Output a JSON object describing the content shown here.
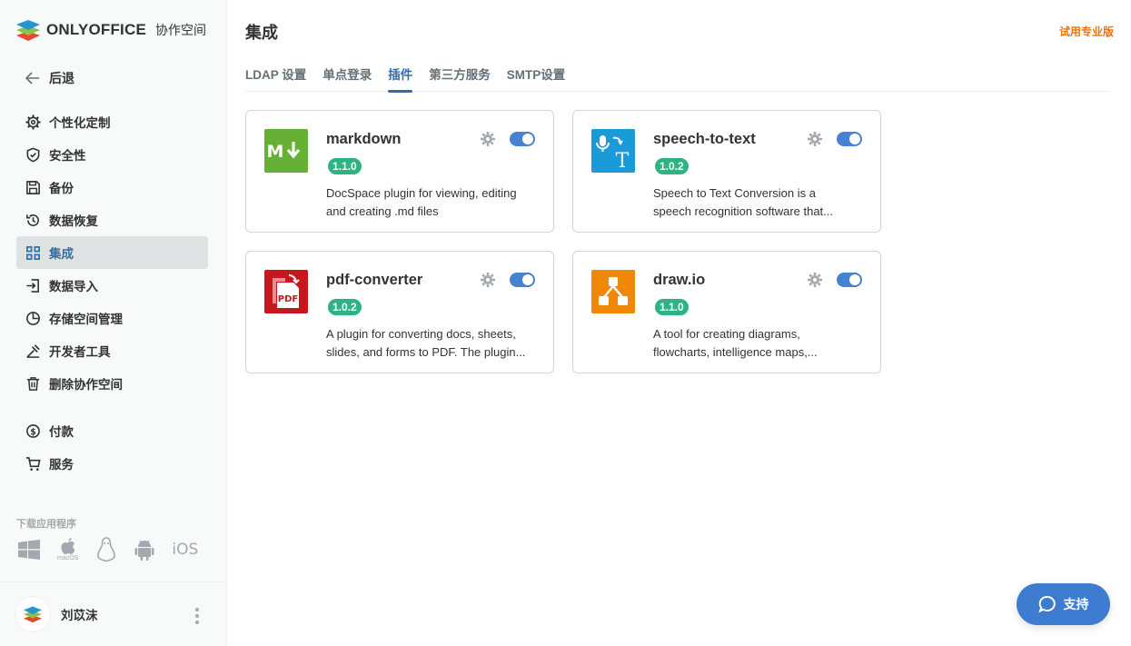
{
  "sidebar": {
    "logo_text": "ONLYOFFICE",
    "logo_sub": "协作空间",
    "back_label": "后退",
    "items": [
      {
        "label": "个性化定制",
        "icon": "gear-icon"
      },
      {
        "label": "安全性",
        "icon": "shield-icon"
      },
      {
        "label": "备份",
        "icon": "save-icon"
      },
      {
        "label": "数据恢复",
        "icon": "history-icon"
      },
      {
        "label": "集成",
        "icon": "grid-icon",
        "active": true
      },
      {
        "label": "数据导入",
        "icon": "import-icon"
      },
      {
        "label": "存储空间管理",
        "icon": "pie-chart-icon"
      },
      {
        "label": "开发者工具",
        "icon": "tools-icon"
      },
      {
        "label": "删除协作空间",
        "icon": "trash-icon"
      }
    ],
    "items2": [
      {
        "label": "付款",
        "icon": "dollar-icon"
      },
      {
        "label": "服务",
        "icon": "cart-icon"
      }
    ],
    "apps_label": "下载应用程序",
    "apps": {
      "macos": "macOS",
      "ios": "iOS"
    },
    "profile_name": "刘苡沫"
  },
  "main": {
    "title": "集成",
    "trial_link": "试用专业版",
    "tabs": [
      {
        "label": "LDAP 设置"
      },
      {
        "label": "单点登录"
      },
      {
        "label": "插件",
        "active": true
      },
      {
        "label": "第三方服务"
      },
      {
        "label": "SMTP设置"
      }
    ],
    "plugins": [
      {
        "name": "markdown",
        "version": "1.1.0",
        "desc1": "DocSpace plugin for viewing, editing",
        "desc2": "and creating .md files",
        "enabled": true
      },
      {
        "name": "speech-to-text",
        "version": "1.0.2",
        "desc1": "Speech to Text Conversion is a",
        "desc2": "speech recognition software that...",
        "enabled": true
      },
      {
        "name": "pdf-converter",
        "version": "1.0.2",
        "desc1": "A plugin for converting docs, sheets,",
        "desc2": "slides, and forms to PDF. The plugin...",
        "enabled": true,
        "icon_text": "PDF"
      },
      {
        "name": "draw.io",
        "version": "1.1.0",
        "desc1": "A tool for creating diagrams,",
        "desc2": "flowcharts, intelligence maps,...",
        "enabled": true
      }
    ]
  },
  "support_label": "支持",
  "colors": {
    "accent": "#316daa",
    "toggle": "#4781d1",
    "badge": "#2db482",
    "trial": "#ed7309"
  }
}
